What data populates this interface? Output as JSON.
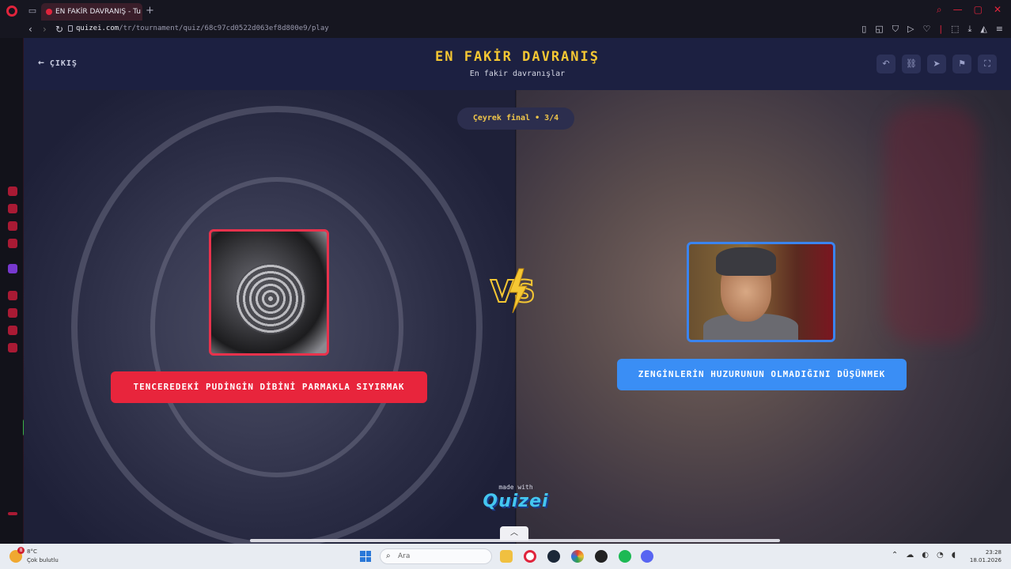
{
  "browser": {
    "tab_title": "EN FAKİR DAVRANIŞ - Tu",
    "url_host": "quizei.com",
    "url_path": "/tr/tournament/quiz/68c97cd0522d063ef8d800e9/play"
  },
  "header": {
    "exit_label": "ÇIKIŞ",
    "title": "EN FAKİR DAVRANIŞ",
    "subtitle": "En fakir davranışlar"
  },
  "arena": {
    "round_label": "Çeyrek final • 3/4",
    "left_option": {
      "label": "TENCEREDEKİ PUDİNGİN DİBİNİ PARMAKLA SIYIRMAK",
      "color": "#e8253c"
    },
    "right_option": {
      "label": "ZENGİNLERİN HUZURUNUN OLMADIĞINI DÜŞÜNMEK",
      "color": "#3a8ef5"
    },
    "vs_label": "VS"
  },
  "footer": {
    "made_with": "made with",
    "brand": "Quizei"
  },
  "taskbar": {
    "weather_temp": "8°C",
    "weather_desc": "Çok bulutlu",
    "weather_badge": "8",
    "search_placeholder": "Ara",
    "time": "23:28",
    "date": "18.01.2026"
  },
  "colors": {
    "accent_title": "#f5c733",
    "header_bg": "#1c2041"
  }
}
